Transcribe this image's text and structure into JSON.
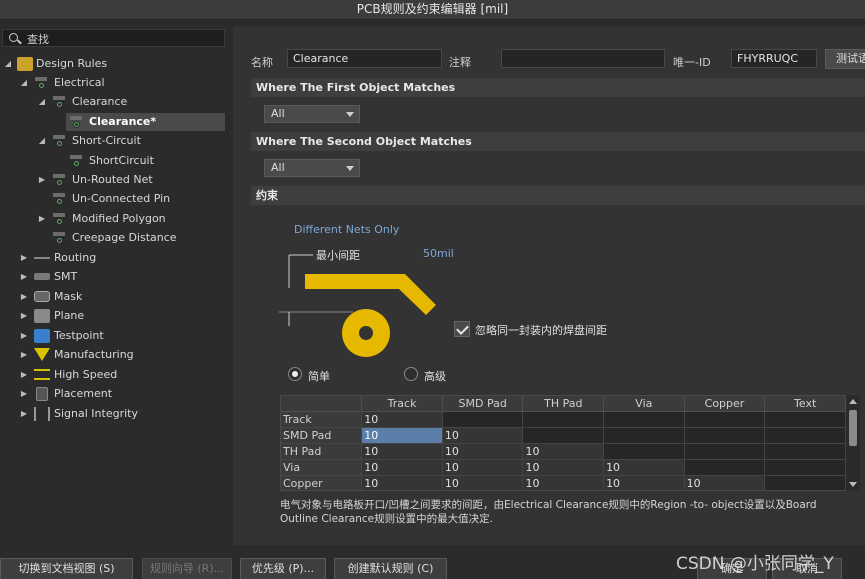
{
  "window": {
    "title": "PCB规则及约束编辑器 [mil]"
  },
  "search": {
    "label": "查找"
  },
  "tree": {
    "root": "Design Rules",
    "electrical": "Electrical",
    "clearance": "Clearance",
    "clearance_child": "Clearance*",
    "short_circuit": "Short-Circuit",
    "short_circuit_child": "ShortCircuit",
    "unrouted": "Un-Routed Net",
    "unconnected": "Un-Connected Pin",
    "modified_polygon": "Modified Polygon",
    "creepage": "Creepage Distance",
    "routing": "Routing",
    "smt": "SMT",
    "mask": "Mask",
    "plane": "Plane",
    "testpoint": "Testpoint",
    "manufacturing": "Manufacturing",
    "high_speed": "High Speed",
    "placement": "Placement",
    "signal_integrity": "Signal Integrity"
  },
  "form": {
    "name_label": "名称",
    "name_value": "Clearance",
    "comment_label": "注释",
    "comment_value": "",
    "uid_label": "唯一-ID",
    "uid_value": "FHYRRUQC",
    "test_button": "测试语句"
  },
  "first_match": {
    "title": "Where The First Object Matches",
    "value": "All"
  },
  "second_match": {
    "title": "Where The Second Object Matches",
    "value": "All"
  },
  "constraints": {
    "title": "约束",
    "different_nets": "Different Nets Only",
    "min_clearance_label": "最小间距",
    "min_clearance_value": "50mil",
    "ignore_pad_label": "忽略同一封装内的焊盘间距",
    "simple_label": "简单",
    "advanced_label": "高级"
  },
  "matrix": {
    "columns": [
      "Track",
      "SMD Pad",
      "TH Pad",
      "Via",
      "Copper",
      "Text"
    ],
    "rows": [
      {
        "label": "Track",
        "values": [
          "10",
          "",
          "",
          "",
          "",
          ""
        ]
      },
      {
        "label": "SMD Pad",
        "values": [
          "10",
          "10",
          "",
          "",
          "",
          ""
        ]
      },
      {
        "label": "TH Pad",
        "values": [
          "10",
          "10",
          "10",
          "",
          "",
          ""
        ]
      },
      {
        "label": "Via",
        "values": [
          "10",
          "10",
          "10",
          "10",
          "",
          ""
        ]
      },
      {
        "label": "Copper",
        "values": [
          "10",
          "10",
          "10",
          "10",
          "10",
          ""
        ]
      }
    ]
  },
  "description": "电气对象与电路板开口/凹槽之间要求的间距，由Electrical Clearance规则中的Region -to- object设置以及Board Outline Clearance规则设置中的最大值决定.",
  "bottom": {
    "doc_view": "切换到文档视图 (S)",
    "rule_wizard": "规则向导 (R)...",
    "priority": "优先级 (P)...",
    "create_default": "创建默认规则 (C)",
    "ok": "确定",
    "cancel": "取消"
  },
  "watermark": "CSDN @小张同学_Y",
  "colors": {
    "copper": "#e6b800",
    "selection": "#5b7fa8",
    "accent_text": "#7fa7d8"
  }
}
